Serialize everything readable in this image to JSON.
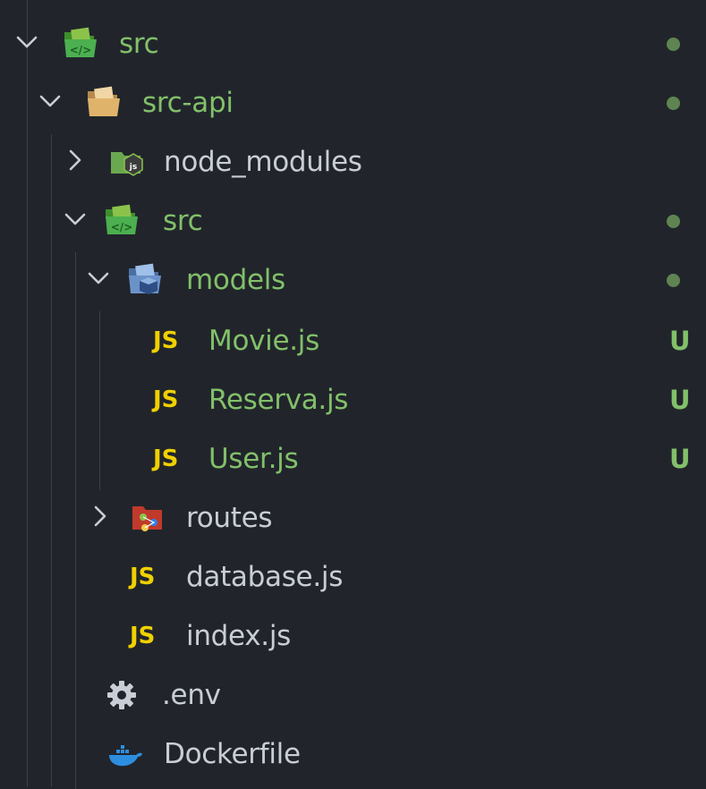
{
  "tree": {
    "root": {
      "label": "src",
      "expanded": true,
      "git_status": "modified",
      "icon": "folder-src-open-icon"
    },
    "src_api": {
      "label": "src-api",
      "expanded": true,
      "git_status": "modified",
      "icon": "folder-open-icon"
    },
    "node_modules": {
      "label": "node_modules",
      "expanded": false,
      "icon": "folder-node-icon"
    },
    "src_inner": {
      "label": "src",
      "expanded": true,
      "git_status": "modified",
      "icon": "folder-src-open-icon"
    },
    "models": {
      "label": "models",
      "expanded": true,
      "git_status": "modified",
      "icon": "folder-models-icon"
    },
    "movie": {
      "label": "Movie.js",
      "badge": "JS",
      "status": "U"
    },
    "reserva": {
      "label": "Reserva.js",
      "badge": "JS",
      "status": "U"
    },
    "user": {
      "label": "User.js",
      "badge": "JS",
      "status": "U"
    },
    "routes": {
      "label": "routes",
      "expanded": false,
      "icon": "folder-routes-icon"
    },
    "database": {
      "label": "database.js",
      "badge": "JS"
    },
    "index": {
      "label": "index.js",
      "badge": "JS"
    },
    "env": {
      "label": ".env",
      "icon": "gear-icon"
    },
    "dockerfile": {
      "label": "Dockerfile",
      "icon": "docker-icon"
    }
  },
  "colors": {
    "background": "#21252b",
    "text": "#c9ced6",
    "untracked_green": "#82c06a",
    "modified_dot": "#5f8451",
    "js_yellow": "#f0d000"
  }
}
